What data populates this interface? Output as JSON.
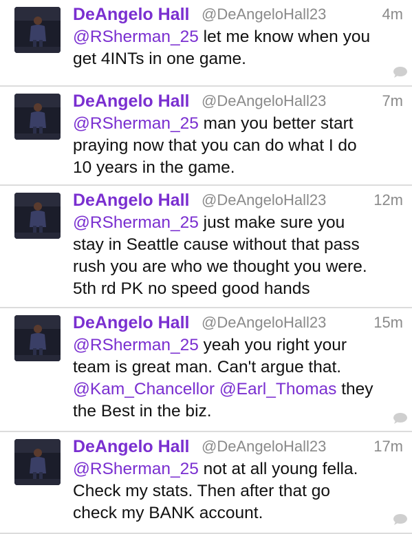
{
  "colors": {
    "name": "#7a2fd0",
    "mention": "#7a2fd0",
    "meta": "#8a8a8a",
    "divider": "#dcdcdc",
    "text": "#111111"
  },
  "icons": {
    "avatar": "profile-photo",
    "reply": "speech-bubble-icon"
  },
  "tweets": [
    {
      "name": "DeAngelo Hall",
      "handle": "@DeAngeloHall23",
      "time": "4m",
      "line1_mention": "@RSherman_25",
      "line1_text": " let me know when you",
      "line2": "get 4INTs in one game."
    },
    {
      "name": "DeAngelo Hall",
      "handle": "@DeAngeloHall23",
      "time": "7m",
      "line1_mention": "@RSherman_25",
      "line1_text": " man you better start",
      "line2": "praying now that you can do what I do",
      "line3": "10 years in the game."
    },
    {
      "name": "DeAngelo Hall",
      "handle": "@DeAngeloHall23",
      "time": "12m",
      "line1_mention": "@RSherman_25",
      "line1_text": " just make sure you",
      "line2": "stay in Seattle cause without that pass",
      "line3": "rush you are who we thought you were.",
      "line4": "5th rd PK no speed good hands"
    },
    {
      "name": "DeAngelo Hall",
      "handle": "@DeAngeloHall23",
      "time": "15m",
      "line1_mention": "@RSherman_25",
      "line1_text": " yeah you right your",
      "line2": "team is great man. Can't argue that.",
      "line3_mention_a": "@Kam_Chancellor",
      "line3_space": " ",
      "line3_mention_b": "@Earl_Thomas",
      "line3_text": " they",
      "line4": "the Best in the biz."
    },
    {
      "name": "DeAngelo Hall",
      "handle": "@DeAngeloHall23",
      "time": "17m",
      "line1_mention": "@RSherman_25",
      "line1_text": " not at all young fella.",
      "line2": "Check my stats. Then after that go",
      "line3": "check my BANK account."
    }
  ]
}
